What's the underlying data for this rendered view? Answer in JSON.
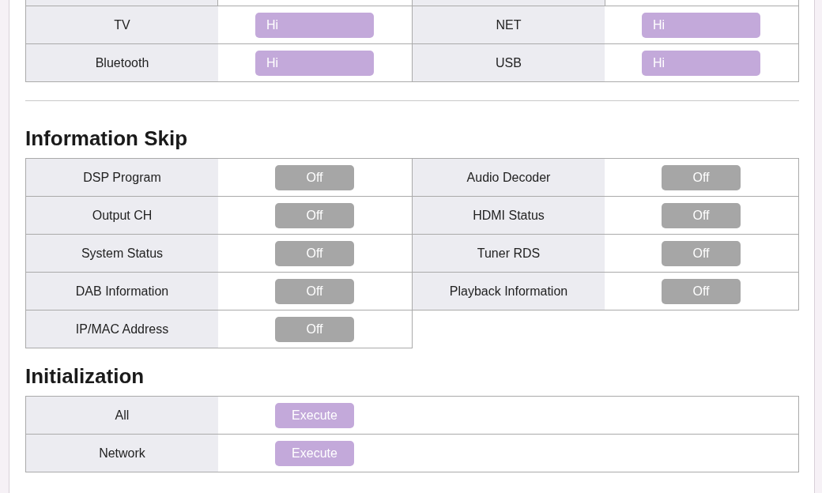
{
  "sections": [
    {
      "items": [
        {
          "kind": "select",
          "label": "TV",
          "value": "Hi"
        },
        {
          "kind": "select",
          "label": "NET",
          "value": "Hi"
        },
        {
          "kind": "select",
          "label": "Bluetooth",
          "value": "Hi"
        },
        {
          "kind": "select",
          "label": "USB",
          "value": "Hi"
        }
      ]
    },
    {
      "title": "Information Skip",
      "items": [
        {
          "kind": "toggle",
          "label": "DSP Program",
          "value": "Off"
        },
        {
          "kind": "toggle",
          "label": "Audio Decoder",
          "value": "Off"
        },
        {
          "kind": "toggle",
          "label": "Output CH",
          "value": "Off"
        },
        {
          "kind": "toggle",
          "label": "HDMI Status",
          "value": "Off"
        },
        {
          "kind": "toggle",
          "label": "System Status",
          "value": "Off"
        },
        {
          "kind": "toggle",
          "label": "Tuner RDS",
          "value": "Off"
        },
        {
          "kind": "toggle",
          "label": "DAB Information",
          "value": "Off"
        },
        {
          "kind": "toggle",
          "label": "Playback Information",
          "value": "Off"
        },
        {
          "kind": "toggle",
          "label": "IP/MAC Address",
          "value": "Off"
        }
      ]
    },
    {
      "title": "Initialization",
      "items": [
        {
          "kind": "button",
          "label": "All",
          "value": "Execute"
        },
        {
          "kind": "button",
          "label": "Network",
          "value": "Execute"
        }
      ]
    }
  ]
}
